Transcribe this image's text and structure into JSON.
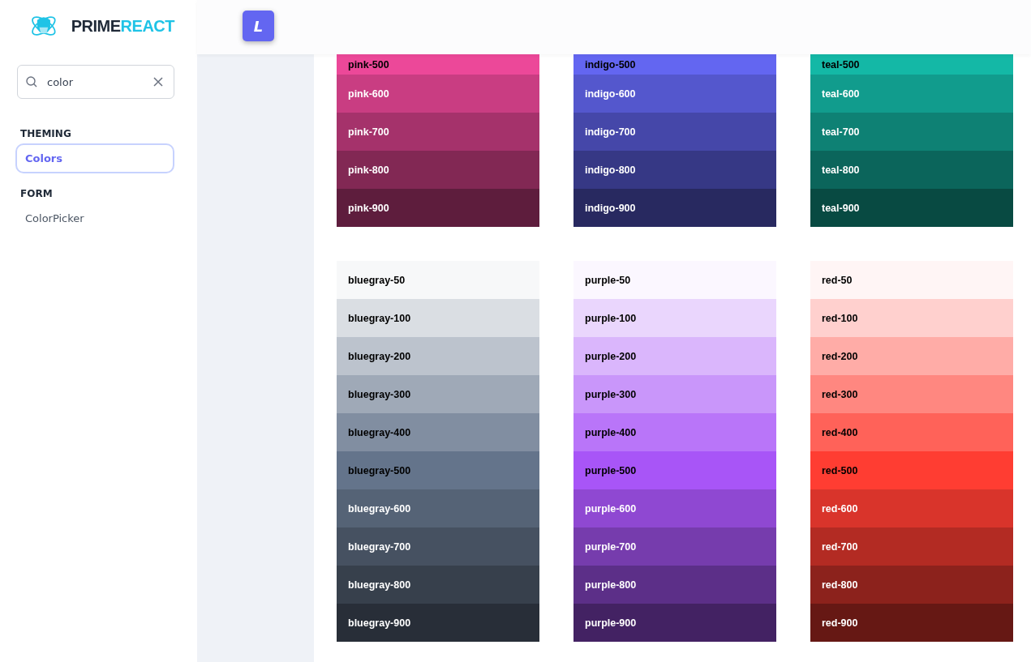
{
  "sidebar": {
    "logo": {
      "part_1": "PRIME",
      "part_2": "REACT"
    },
    "search": {
      "value": "color"
    },
    "sections": [
      {
        "title": "THEMING",
        "items": [
          {
            "label": "Colors",
            "selected": true
          }
        ]
      },
      {
        "title": "FORM",
        "items": [
          {
            "label": "ColorPicker",
            "selected": false
          }
        ]
      }
    ]
  },
  "topbar": {
    "button": "L"
  },
  "palette_groups": [
    {
      "palettes": [
        {
          "swatches": [
            {
              "name": "pink-500",
              "color": "#ec4899",
              "dark_text": true
            },
            {
              "name": "pink-600",
              "color": "#c93d82",
              "dark_text": false
            },
            {
              "name": "pink-700",
              "color": "#a5326b",
              "dark_text": false
            },
            {
              "name": "pink-800",
              "color": "#822854",
              "dark_text": false
            },
            {
              "name": "pink-900",
              "color": "#5e1d3d",
              "dark_text": false
            }
          ]
        },
        {
          "swatches": [
            {
              "name": "indigo-500",
              "color": "#6366f1",
              "dark_text": true
            },
            {
              "name": "indigo-600",
              "color": "#5457cd",
              "dark_text": false
            },
            {
              "name": "indigo-700",
              "color": "#4547a9",
              "dark_text": false
            },
            {
              "name": "indigo-800",
              "color": "#363885",
              "dark_text": false
            },
            {
              "name": "indigo-900",
              "color": "#282960",
              "dark_text": false
            }
          ]
        },
        {
          "swatches": [
            {
              "name": "teal-500",
              "color": "#14b8a6",
              "dark_text": true
            },
            {
              "name": "teal-600",
              "color": "#119c8d",
              "dark_text": false
            },
            {
              "name": "teal-700",
              "color": "#0e8174",
              "dark_text": false
            },
            {
              "name": "teal-800",
              "color": "#0b655b",
              "dark_text": false
            },
            {
              "name": "teal-900",
              "color": "#084a42",
              "dark_text": false
            }
          ]
        }
      ]
    },
    {
      "palettes": [
        {
          "swatches": [
            {
              "name": "bluegray-50",
              "color": "#f7f8f9",
              "dark_text": true
            },
            {
              "name": "bluegray-100",
              "color": "#dadee3",
              "dark_text": true
            },
            {
              "name": "bluegray-200",
              "color": "#bcc3cd",
              "dark_text": true
            },
            {
              "name": "bluegray-300",
              "color": "#9fa9b7",
              "dark_text": true
            },
            {
              "name": "bluegray-400",
              "color": "#818ea1",
              "dark_text": true
            },
            {
              "name": "bluegray-500",
              "color": "#64748b",
              "dark_text": true
            },
            {
              "name": "bluegray-600",
              "color": "#556376",
              "dark_text": false
            },
            {
              "name": "bluegray-700",
              "color": "#465161",
              "dark_text": false
            },
            {
              "name": "bluegray-800",
              "color": "#37404c",
              "dark_text": false
            },
            {
              "name": "bluegray-900",
              "color": "#282e38",
              "dark_text": false
            }
          ]
        },
        {
          "swatches": [
            {
              "name": "purple-50",
              "color": "#fbf7ff",
              "dark_text": true
            },
            {
              "name": "purple-100",
              "color": "#ead6fd",
              "dark_text": true
            },
            {
              "name": "purple-200",
              "color": "#dab6fc",
              "dark_text": true
            },
            {
              "name": "purple-300",
              "color": "#c996fa",
              "dark_text": true
            },
            {
              "name": "purple-400",
              "color": "#b975f9",
              "dark_text": true
            },
            {
              "name": "purple-500",
              "color": "#a855f7",
              "dark_text": true
            },
            {
              "name": "purple-600",
              "color": "#8f48d2",
              "dark_text": false
            },
            {
              "name": "purple-700",
              "color": "#763cad",
              "dark_text": false
            },
            {
              "name": "purple-800",
              "color": "#5c2f88",
              "dark_text": false
            },
            {
              "name": "purple-900",
              "color": "#432263",
              "dark_text": false
            }
          ]
        },
        {
          "swatches": [
            {
              "name": "red-50",
              "color": "#fff5f5",
              "dark_text": true
            },
            {
              "name": "red-100",
              "color": "#ffd0ce",
              "dark_text": true
            },
            {
              "name": "red-200",
              "color": "#ffaca7",
              "dark_text": true
            },
            {
              "name": "red-300",
              "color": "#ff8780",
              "dark_text": true
            },
            {
              "name": "red-400",
              "color": "#ff6259",
              "dark_text": true
            },
            {
              "name": "red-500",
              "color": "#ff3d32",
              "dark_text": true
            },
            {
              "name": "red-600",
              "color": "#d9342b",
              "dark_text": false
            },
            {
              "name": "red-700",
              "color": "#b32b23",
              "dark_text": false
            },
            {
              "name": "red-800",
              "color": "#8c221c",
              "dark_text": false
            },
            {
              "name": "red-900",
              "color": "#661814",
              "dark_text": false
            }
          ]
        }
      ]
    }
  ]
}
